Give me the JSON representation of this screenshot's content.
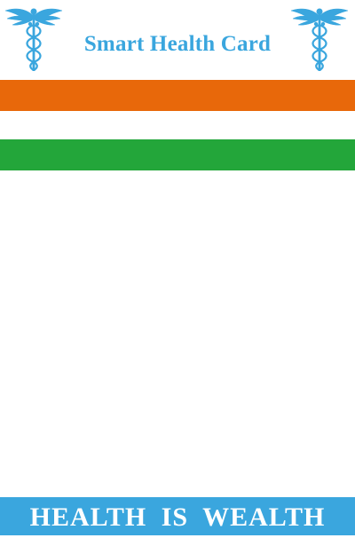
{
  "header": {
    "title": "Smart Health Card",
    "left_icon": "caduceus-icon",
    "right_icon": "caduceus-icon"
  },
  "stripes": {
    "saffron": "#E8680A",
    "white": "#FFFFFF",
    "green": "#23A63A"
  },
  "footer": {
    "text": "HEALTH IS WEALTH"
  },
  "colors": {
    "accent": "#3AA6DE",
    "footer_bg": "#3AA6DE",
    "background": "#FFFFFF"
  }
}
